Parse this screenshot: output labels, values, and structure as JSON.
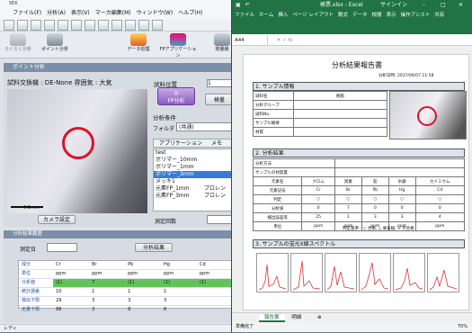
{
  "left_app": {
    "title": "SEK",
    "menu": [
      "ファイル(F)",
      "分析(A)",
      "表示(V)",
      "マーカ編集(M)",
      "ウィンドウ(W)",
      "ヘルプ(H)"
    ],
    "big_buttons": [
      "らくらく分析",
      "ポイント分析",
      "データ処理",
      "FPアプリケーション",
      "検量線"
    ],
    "panel_title": "ポイント分析",
    "sample_info": "試料交換機 : DE-None   雰囲気 : 大気",
    "position_label": "試料位置",
    "position_value": "1",
    "scale_label": "0.5mm",
    "fp_button": "FP分析",
    "calib_button": "検量",
    "condition_label": "分析条件",
    "folder_label": "フォルダ",
    "folder_value": "(共通)",
    "list_header": [
      "アプリケーション",
      "メモ"
    ],
    "list_items": [
      "test",
      "ポリマー_10mm",
      "ポリマー_1mm",
      "ポリマー_3mm",
      "メッキ1",
      "元素FP_1mm",
      "元素FP_3mm"
    ],
    "list_selected_index": 3,
    "list_memo": [
      "",
      "",
      "",
      "",
      "",
      "プロレン",
      "プロレン"
    ],
    "camera_button": "カメラ設定",
    "measure_count": "測定回数",
    "result_header": "分析結果履歴",
    "measure_label": "測定日",
    "analysis_button": "分析結果",
    "table": {
      "rows": [
        {
          "label": "成分",
          "values": [
            "Cr",
            "Br",
            "Pb",
            "Hg",
            "Cd"
          ]
        },
        {
          "label": "単位",
          "values": [
            "ppm",
            "ppm",
            "ppm",
            "ppm",
            "ppm"
          ]
        },
        {
          "label": "分析値",
          "values": [
            "(1)",
            "7",
            "(1)",
            "(1)",
            "(1)"
          ]
        },
        {
          "label": "統計誤差",
          "values": [
            "10",
            "1",
            "1",
            "1",
            ""
          ]
        },
        {
          "label": "検出下限",
          "values": [
            "29",
            "3",
            "3",
            "3",
            ""
          ]
        },
        {
          "label": "定量下限",
          "values": [
            "88",
            "3",
            "8",
            "8",
            ""
          ]
        }
      ]
    },
    "status": "レディ"
  },
  "excel": {
    "title": "帳票.xlsx - Excel",
    "signin": "サインイン",
    "ribbon_tabs": [
      "ファイル",
      "ホーム",
      "挿入",
      "ページ レイアウト",
      "数式",
      "データ",
      "校閲",
      "表示",
      "操作アシスト",
      "共有"
    ],
    "cell_ref": "A44",
    "report_title": "分析結果報告書",
    "report_date_label": "分析日時:",
    "report_date": "2017/06/07 11:58",
    "sec1": "1. サンプル情報",
    "sec1_rows": [
      [
        "試料名",
        "樹脂"
      ],
      [
        "分析グループ",
        ""
      ],
      [
        "試料No.",
        ""
      ],
      [
        "サンプル概要",
        ""
      ],
      [
        "材質",
        ""
      ]
    ],
    "sec2": "2. 分析結果",
    "sec2_meta": [
      "分析方法",
      "サンプルの材質量"
    ],
    "sec2_header": [
      "元素名",
      "クロム",
      "臭素",
      "鉛",
      "水銀",
      "カドミウム"
    ],
    "sec2_rows": [
      [
        "元素記号",
        "Cr",
        "Br",
        "Pb",
        "Hg",
        "Cd"
      ],
      [
        "判定",
        "○",
        "○",
        "○",
        "○",
        "○"
      ],
      [
        "分析値",
        "0",
        "7",
        "0",
        "0",
        "0"
      ],
      [
        "検出誤差等",
        "25",
        "1",
        "3",
        "3",
        "4"
      ],
      [
        "単位",
        "ppm",
        "ppm",
        "ppm",
        "ppm",
        "ppm"
      ]
    ],
    "sec2_note": "判定基準：○ 合格, △ 要再検, × 不合格",
    "sec3": "3. サンプルの蛍光X線スペクトル",
    "sheet_tabs": [
      "報告書",
      "明細"
    ],
    "status": "準備完了",
    "zoom": "70%"
  }
}
